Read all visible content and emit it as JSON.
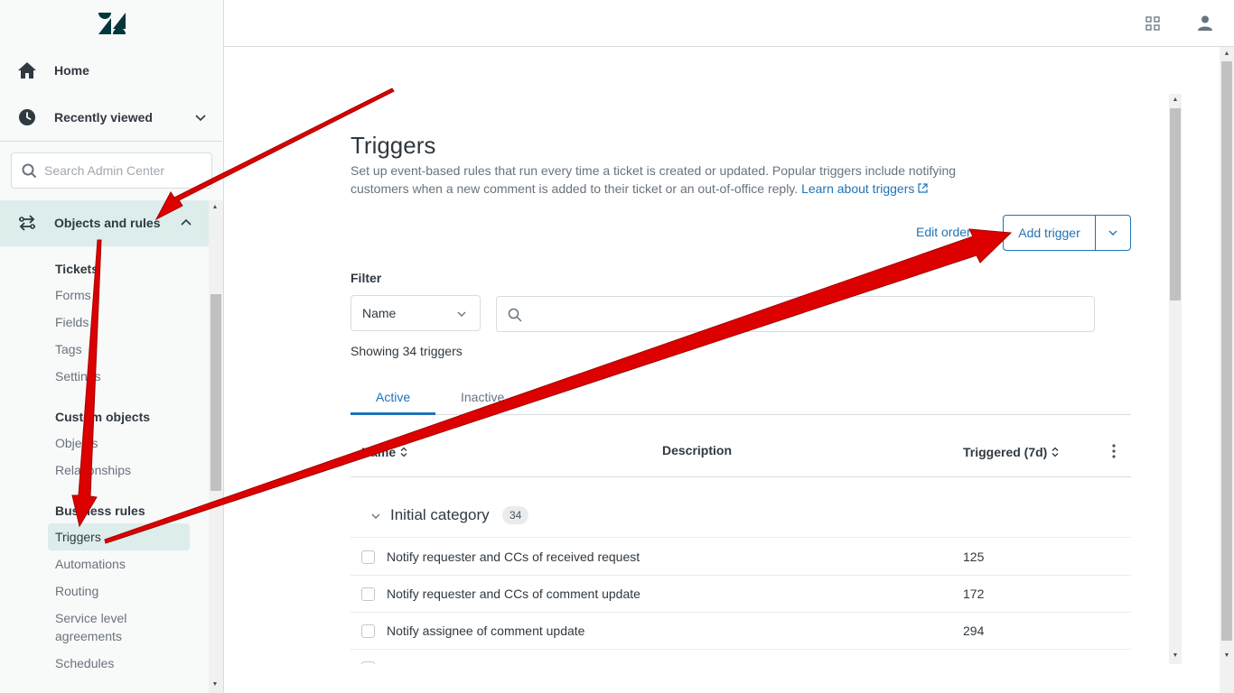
{
  "sidebar": {
    "nav": {
      "home_label": "Home",
      "recent_label": "Recently viewed"
    },
    "search": {
      "placeholder": "Search Admin Center"
    },
    "section": {
      "label": "Objects and rules"
    },
    "groups": {
      "tickets": {
        "heading": "Tickets",
        "items": [
          "Forms",
          "Fields",
          "Tags",
          "Settings"
        ]
      },
      "custom_objects": {
        "heading": "Custom objects",
        "items": [
          "Objects",
          "Relationships"
        ]
      },
      "business_rules": {
        "heading": "Business rules",
        "active": "Triggers",
        "items": [
          "Automations",
          "Routing",
          "Service level agreements",
          "Schedules"
        ]
      }
    }
  },
  "header": {
    "apps_icon": "grid-icon",
    "user_icon": "user-icon"
  },
  "page": {
    "title": "Triggers",
    "description": "Set up event-based rules that run every time a ticket is created or updated. Popular triggers include notifying customers when a new comment is added to their ticket or an out-of-office reply.",
    "learn_link": "Learn about triggers",
    "edit_order": "Edit order",
    "add_trigger": "Add trigger",
    "filter_label": "Filter",
    "filter_select": "Name",
    "showing": "Showing 34 triggers",
    "tabs": {
      "active": "Active",
      "inactive": "Inactive"
    },
    "columns": {
      "name": "Name",
      "description": "Description",
      "triggered": "Triggered (7d)"
    },
    "group": {
      "name": "Initial category",
      "count": "34"
    },
    "rows": [
      {
        "name": "Notify requester and CCs of received request",
        "count": "125"
      },
      {
        "name": "Notify requester and CCs of comment update",
        "count": "172"
      },
      {
        "name": "Notify assignee of comment update",
        "count": "294"
      }
    ]
  },
  "colors": {
    "accent": "#1f73b7",
    "active_bg": "#dcedeb",
    "annotation_arrow": "#e00000"
  }
}
